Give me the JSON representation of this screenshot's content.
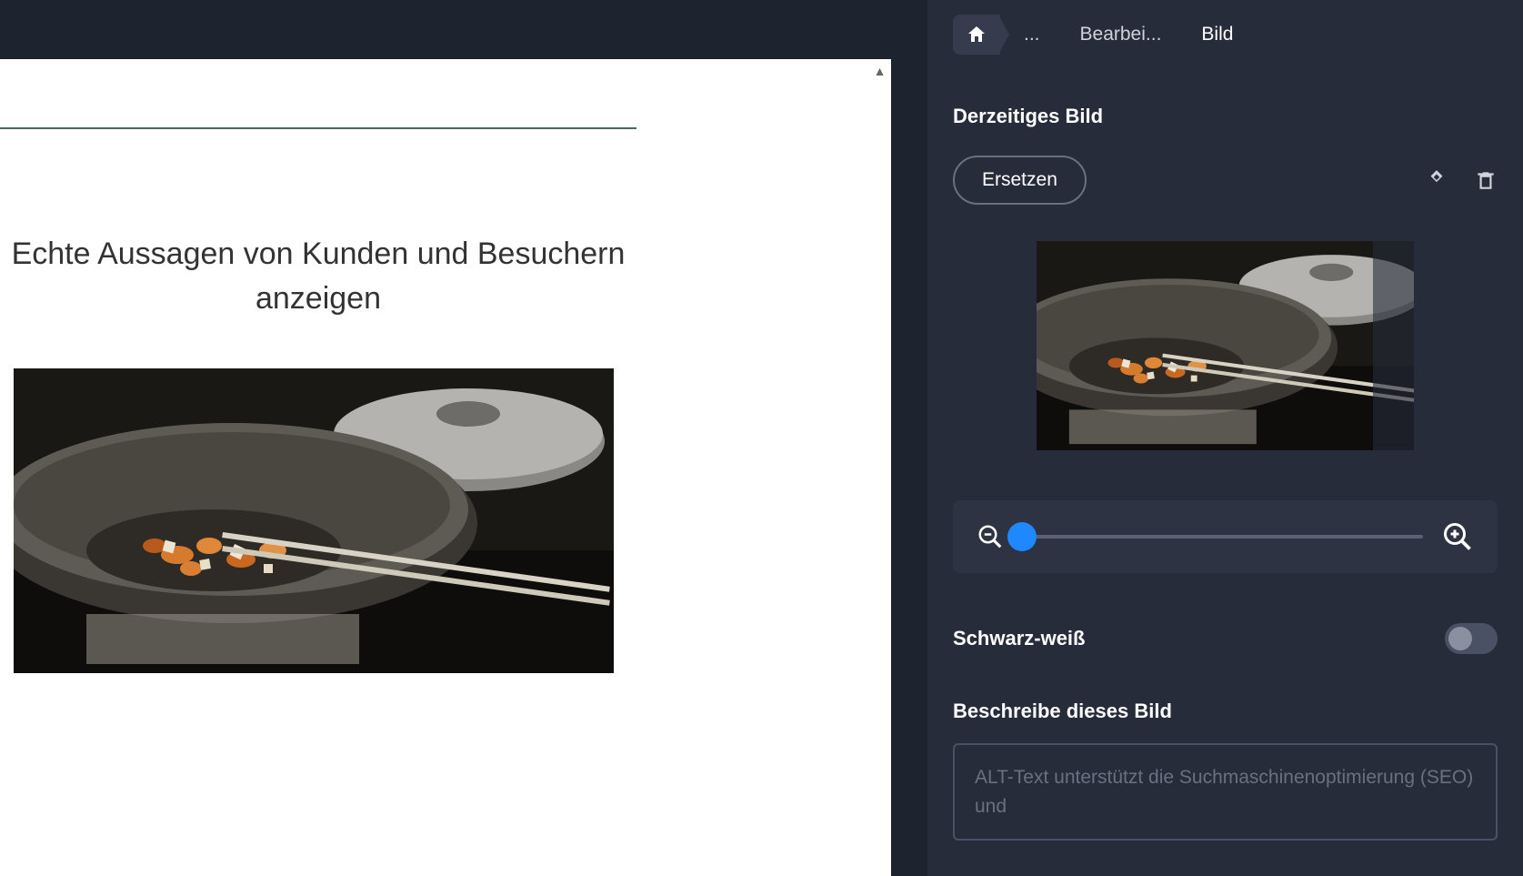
{
  "breadcrumb": {
    "ellipsis": "...",
    "edit": "Bearbei...",
    "current": "Bild"
  },
  "panel": {
    "current_image_label": "Derzeitiges Bild",
    "replace_label": "Ersetzen",
    "zoom_value": 0,
    "bw_label": "Schwarz-weiß",
    "bw_on": false,
    "describe_label": "Beschreibe dieses Bild",
    "alt_placeholder": "ALT-Text unterstützt die Suchmaschinenoptimierung (SEO) und"
  },
  "canvas": {
    "heading": "Echte Aussagen von Kunden und Besuchern anzeigen"
  }
}
